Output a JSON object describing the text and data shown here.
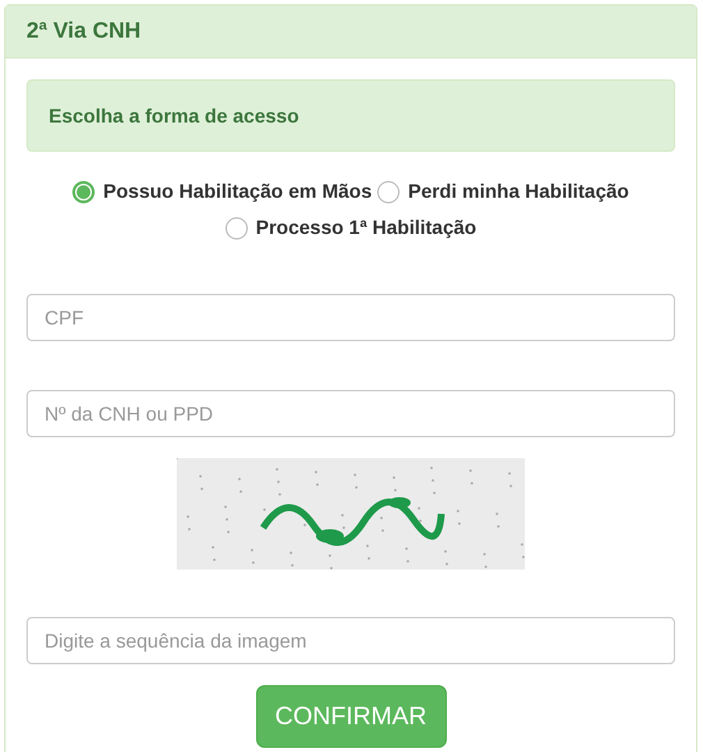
{
  "panel": {
    "title": "2ª Via CNH"
  },
  "alert": {
    "text": "Escolha a forma de acesso"
  },
  "access_options": [
    {
      "label": "Possuo Habilitação em Mãos",
      "selected": true
    },
    {
      "label": "Perdi minha Habilitação",
      "selected": false
    },
    {
      "label": "Processo 1ª Habilitação",
      "selected": false
    }
  ],
  "fields": [
    {
      "placeholder": "CPF"
    },
    {
      "placeholder": "Nº da CNH ou PPD"
    }
  ],
  "captcha_field": {
    "placeholder": "Digite a sequência da imagem"
  },
  "submit": {
    "label": "CONFIRMAR"
  }
}
